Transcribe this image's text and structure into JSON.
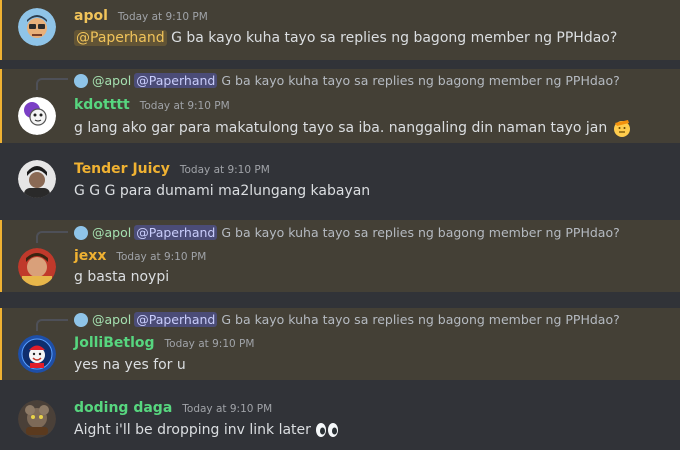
{
  "timestamp": "Today at 9:10 PM",
  "messages": [
    {
      "author": "apol",
      "author_color": "#f0c35a",
      "mention": "@Paperhand",
      "text": " G ba kayo kuha tayo sa replies ng bagong member ng PPHdao?"
    },
    {
      "author": "kdotttt",
      "author_color": "#57d67f",
      "reply": {
        "author": "@apol",
        "mention": "@Paperhand",
        "text": "G ba kayo kuha tayo sa replies ng bagong member ng PPHdao?"
      },
      "text": "g lang ako gar para makatulong tayo sa iba. nanggaling din naman tayo jan",
      "emoji": "saluting-face"
    },
    {
      "author": "Tender Juicy",
      "author_color": "#f0b232",
      "text": "G  G G para dumami ma2lungang kabayan"
    },
    {
      "author": "jexx",
      "author_color": "#f0b232",
      "reply": {
        "author": "@apol",
        "mention": "@Paperhand",
        "text": "G ba kayo kuha tayo sa replies ng bagong member ng PPHdao?"
      },
      "text": "g basta noypi"
    },
    {
      "author": "JolliBetlog",
      "author_color": "#57d67f",
      "reply": {
        "author": "@apol",
        "mention": "@Paperhand",
        "text": "G ba kayo kuha tayo sa replies ng bagong member ng PPHdao?"
      },
      "text": "yes na yes for u"
    },
    {
      "author": "doding daga",
      "author_color": "#57d67f",
      "text": "Aight i'll be dropping inv link later",
      "emoji": "eyes"
    }
  ]
}
